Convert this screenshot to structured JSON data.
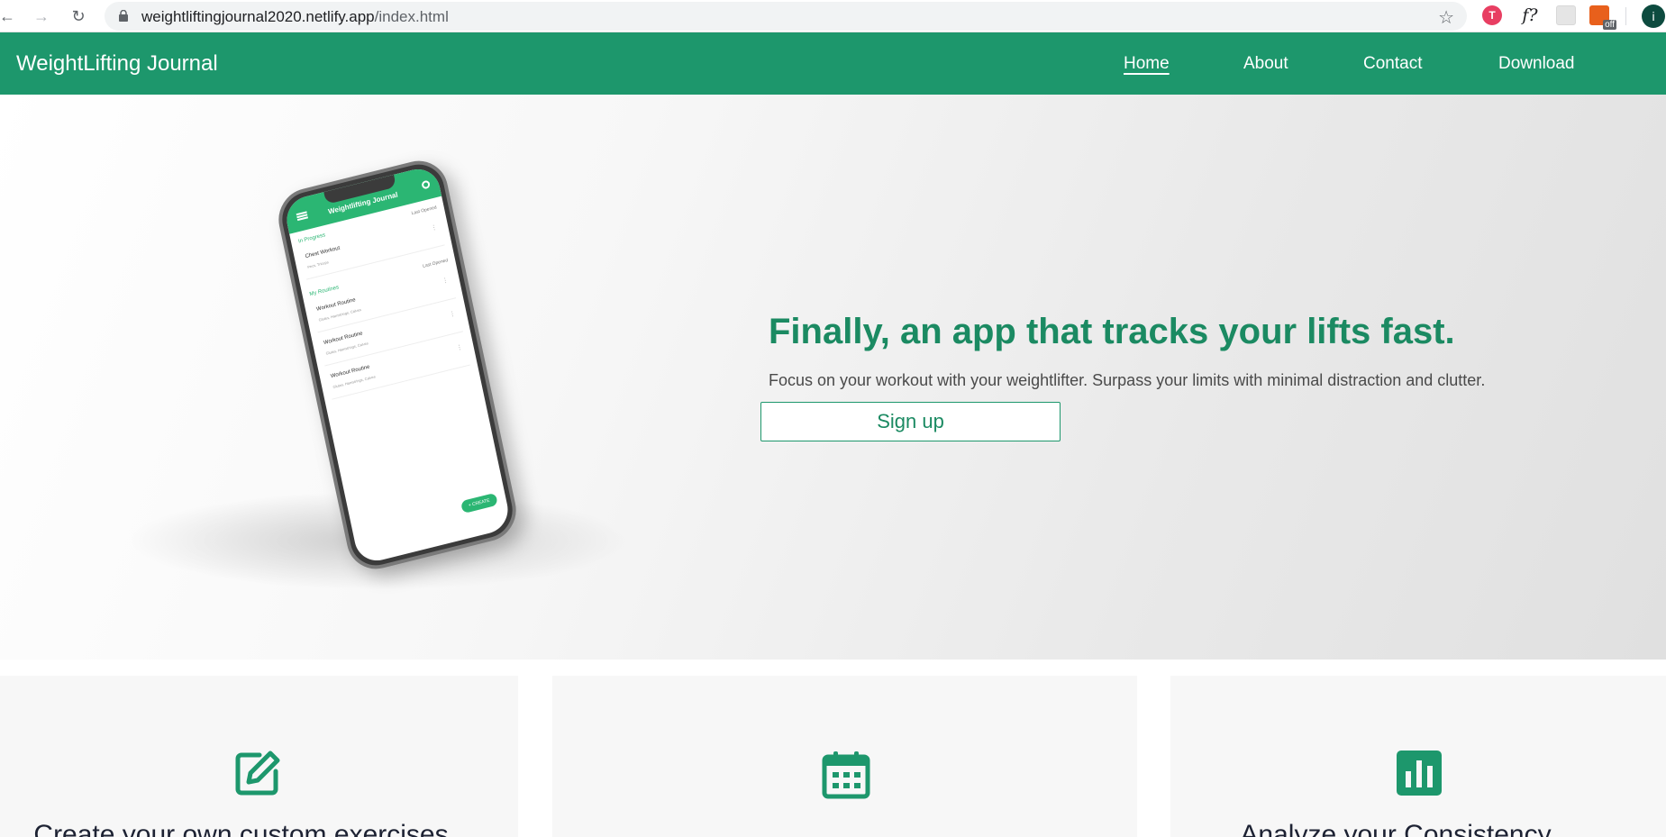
{
  "browser": {
    "url_host": "weightliftingjournal2020.netlify.app",
    "url_path": "/index.html",
    "extension_off_badge": "off",
    "profile_initial": "i",
    "ext_t_label": "T",
    "ext_f_label": "f?"
  },
  "header": {
    "brand": "WeightLifting Journal",
    "nav": {
      "home": "Home",
      "about": "About",
      "contact": "Contact",
      "download": "Download"
    }
  },
  "phone": {
    "app_title": "Weightlifting Journal",
    "in_progress": "In Progress",
    "last_opened": "Last Opened",
    "my_routines": "My Routines",
    "items": [
      {
        "title": "Chest Workout",
        "sub": "Pecs, Triceps"
      },
      {
        "title": "Workout Routine",
        "sub": "Glutes, Hamstrings, Calves"
      },
      {
        "title": "Workout Routine",
        "sub": "Glutes, Hamstrings, Calves"
      },
      {
        "title": "Workout Routine",
        "sub": "Glutes, Hamstrings, Calves"
      }
    ],
    "fab": "+ CREATE"
  },
  "hero": {
    "headline": "Finally, an app that tracks your lifts fast.",
    "subtext": "Focus on your workout with your weightlifter. Surpass your limits with minimal distraction and clutter.",
    "signup_label": "Sign up"
  },
  "features": [
    {
      "title": "Create your own custom exercises",
      "icon": "edit-icon"
    },
    {
      "title": "",
      "icon": "calendar-icon"
    },
    {
      "title": "Analyze your Consistency",
      "icon": "bar-chart-icon"
    }
  ],
  "colors": {
    "brand_green": "#1d976c",
    "headline_green": "#1b8a62",
    "app_green": "#2bb673"
  }
}
